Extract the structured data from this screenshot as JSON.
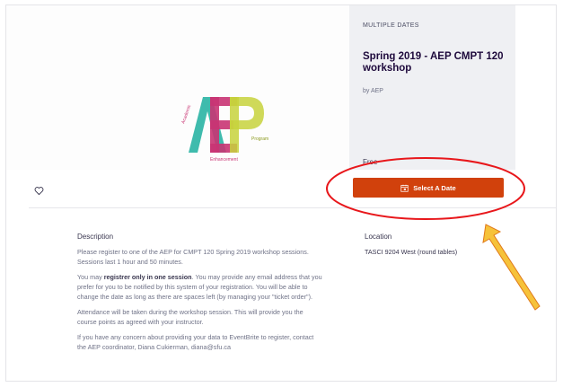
{
  "panel": {
    "tag": "MULTIPLE DATES",
    "title": "Spring 2019 - AEP CMPT 120 workshop",
    "organizer": "by AEP",
    "price": "Free"
  },
  "logo": {
    "main": "AEP",
    "word_left": "Academic",
    "word_right": "Program",
    "word_bottom": "Enhancement"
  },
  "actions": {
    "select_date_label": "Select A Date",
    "icons": {
      "like": "heart-icon",
      "calendar": "calendar-icon"
    }
  },
  "description": {
    "heading": "Description",
    "p1": "Please register to one of the AEP for CMPT 120 Spring 2019 workshop sessions. Sessions last 1 hour and 50 minutes.",
    "p2_prefix": "You may ",
    "p2_bold": "registrer only in one session",
    "p2_suffix": ". You may provide any email address that you prefer for you to be notified by this system of your registration. You will be able to change the date as long as there are spaces left (by managing your \"ticket order\").",
    "p3": "Attendance will be taken during the workshop session. This will provide you the course points as agreed with your instructor.",
    "p4": "If you have any concern about providing your data to EventBrite to register, contact the AEP coordinator, Diana Cukierman, diana@sfu.ca"
  },
  "location": {
    "heading": "Location",
    "value": "TASCI 9204 West (round tables)"
  },
  "colors": {
    "button": "#d1410c",
    "annotation": "#e8171b",
    "arrow_fill": "#f6c23a",
    "arrow_stroke": "#e07a1a",
    "logo_a": "#2fb5a6",
    "logo_e": "#c93473",
    "logo_p": "#c7d23c"
  }
}
